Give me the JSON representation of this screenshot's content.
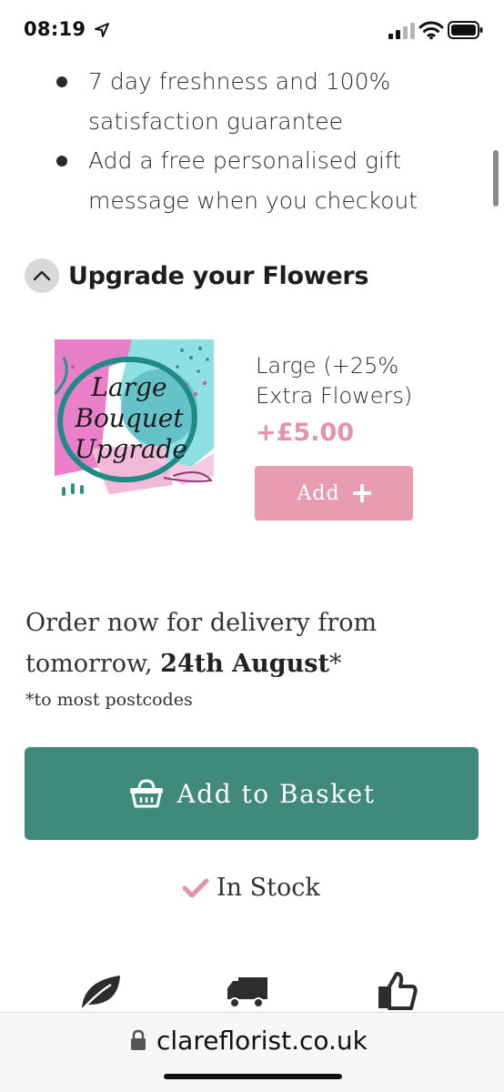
{
  "status_bar": {
    "time": "08:19"
  },
  "bullets": [
    "7 day freshness and 100% satisfaction guarantee",
    "Add a free personalised gift message when you checkout"
  ],
  "upgrade": {
    "title": "Upgrade your Flowers",
    "image_text": [
      "Large",
      "Bouquet",
      "Upgrade"
    ],
    "name": "Large (+25% Extra Flowers)",
    "price": "+£5.00",
    "add_label": "Add"
  },
  "delivery": {
    "prefix": "Order now for delivery from tomorrow, ",
    "date": "24th August",
    "suffix": "*",
    "note": "*to most postcodes"
  },
  "basket_label": "Add to Basket",
  "stock_label": "In Stock",
  "feature_icons": [
    "leaf-icon",
    "delivery-truck-icon",
    "thumbs-up-icon"
  ],
  "address_bar": {
    "url": "clareflorist.co.uk"
  },
  "colors": {
    "accent_green": "#3f8a7b",
    "accent_pink": "#e89cb2",
    "price_pink": "#e493ab"
  }
}
